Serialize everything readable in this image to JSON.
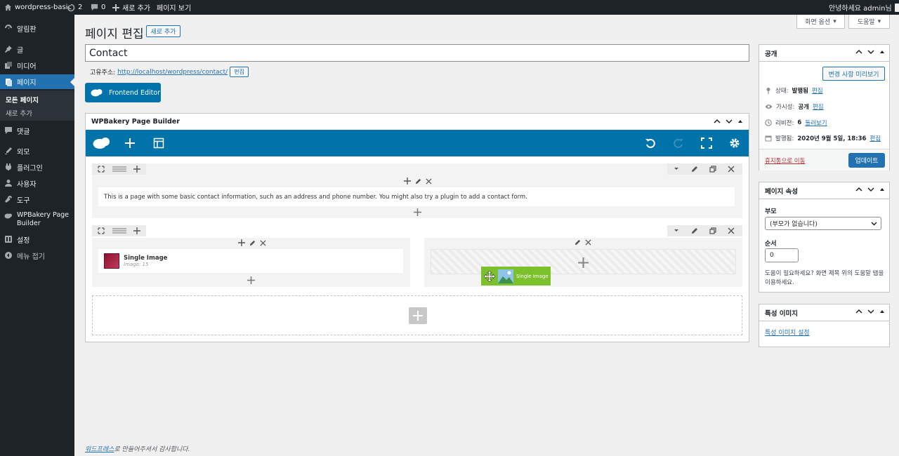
{
  "admin_bar": {
    "site_name": "wordpress-basic",
    "updates_count": "2",
    "comments_count": "0",
    "new_label": "새로 추가",
    "view_page": "페이지 보기",
    "greeting": "안녕하세요 admin님"
  },
  "sidebar": {
    "items": [
      {
        "label": "알림판",
        "icon": "dashboard-icon"
      },
      {
        "label": "글",
        "icon": "pin-icon"
      },
      {
        "label": "미디어",
        "icon": "media-icon"
      },
      {
        "label": "페이지",
        "icon": "page-icon"
      },
      {
        "label": "댓글",
        "icon": "comment-icon"
      },
      {
        "label": "외모",
        "icon": "appearance-icon"
      },
      {
        "label": "플러그인",
        "icon": "plugin-icon"
      },
      {
        "label": "사용자",
        "icon": "user-icon"
      },
      {
        "label": "도구",
        "icon": "tools-icon"
      },
      {
        "label": "WPBakery Page Builder",
        "icon": "wpbakery-icon"
      },
      {
        "label": "설정",
        "icon": "settings-icon"
      },
      {
        "label": "메뉴 접기",
        "icon": "collapse-icon"
      }
    ],
    "submenu": [
      "모든 페이지",
      "새로 추가"
    ]
  },
  "header": {
    "title": "페이지 편집",
    "add_new": "새로 추가",
    "screen_options": "화면 옵션",
    "help": "도움말"
  },
  "editor": {
    "post_title": "Contact",
    "permalink_label": "고유주소:",
    "permalink_url": "http://localhost/wordpress/contact/",
    "permalink_edit": "편집",
    "frontend_editor": "Frontend Editor"
  },
  "wpbakery": {
    "box_title": "WPBakery Page Builder",
    "text_block": "This is a page with some basic contact information, such as an address and phone number. You might also try a plugin to add a contact form.",
    "single_image_title": "Single Image",
    "single_image_meta": "Image: 15",
    "drag_label": "Single Image"
  },
  "publish": {
    "title": "공개",
    "preview_button": "변경 사항 미리보기",
    "status_label": "상태:",
    "status_value": "발행됨",
    "visibility_label": "가시성:",
    "visibility_value": "공개",
    "revisions_label": "리비전:",
    "revisions_value": "6",
    "revisions_link": "둘러보기",
    "published_label": "발행됨:",
    "published_value": "2020년 9월 5일, 18:36",
    "edit_link": "편집",
    "trash_link": "휴지통으로 이동",
    "update_button": "업데이트"
  },
  "page_attributes": {
    "title": "페이지 속성",
    "parent_label": "부모",
    "parent_value": "(부모가 없습니다)",
    "order_label": "순서",
    "order_value": "0",
    "help_text": "도움이 필요하세요? 화면 제목 위의 도움말 탭을 이용하세요."
  },
  "featured_image": {
    "title": "특성 이미지",
    "set_link": "특성 이미지 설정"
  },
  "footer": {
    "link": "워드프레스",
    "text": "로 만들어주셔서 감사합니다."
  },
  "colors": {
    "admin_dark": "#1d2327",
    "accent_blue": "#2271b1",
    "wpb_blue": "#0073aa",
    "drag_green": "#7cc02c"
  }
}
